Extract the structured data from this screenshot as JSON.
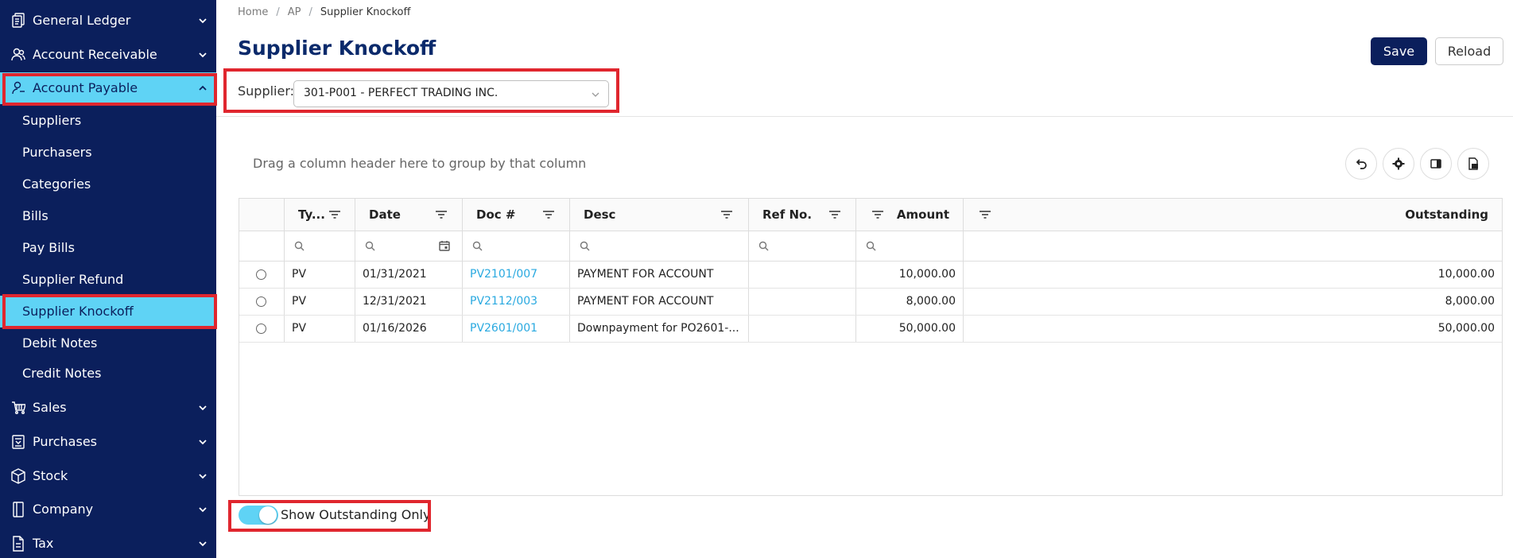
{
  "sidebar": {
    "groups": [
      {
        "label": "General Ledger",
        "icon": "ledger-icon"
      },
      {
        "label": "Account Receivable",
        "icon": "receivable-icon"
      },
      {
        "label": "Account Payable",
        "icon": "payable-icon"
      },
      {
        "label": "Sales",
        "icon": "cart-icon"
      },
      {
        "label": "Purchases",
        "icon": "purchase-doc-icon"
      },
      {
        "label": "Stock",
        "icon": "box-icon"
      },
      {
        "label": "Company",
        "icon": "building-icon"
      },
      {
        "label": "Tax",
        "icon": "tax-doc-icon"
      }
    ],
    "payable_items": [
      "Suppliers",
      "Purchasers",
      "Categories",
      "Bills",
      "Pay Bills",
      "Supplier Refund",
      "Supplier Knockoff",
      "Debit Notes",
      "Credit Notes"
    ],
    "active_item": "Supplier Knockoff"
  },
  "breadcrumb": {
    "home": "Home",
    "ap": "AP",
    "current": "Supplier Knockoff"
  },
  "page": {
    "title": "Supplier Knockoff"
  },
  "toolbar": {
    "save_label": "Save",
    "reload_label": "Reload"
  },
  "supplier": {
    "label": "Supplier:",
    "value": "301-P001 - PERFECT TRADING INC."
  },
  "grid": {
    "group_hint": "Drag a column header here to group by that column",
    "columns": [
      "Ty...",
      "Date",
      "Doc #",
      "Desc",
      "Ref No.",
      "Amount",
      "Outstanding"
    ],
    "rows": [
      {
        "type": "PV",
        "date": "01/31/2021",
        "doc": "PV2101/007",
        "desc": "PAYMENT FOR ACCOUNT",
        "ref": "",
        "amount": "10,000.00",
        "outstanding": "10,000.00"
      },
      {
        "type": "PV",
        "date": "12/31/2021",
        "doc": "PV2112/003",
        "desc": "PAYMENT FOR ACCOUNT",
        "ref": "",
        "amount": "8,000.00",
        "outstanding": "8,000.00"
      },
      {
        "type": "PV",
        "date": "01/16/2026",
        "doc": "PV2601/001",
        "desc": "Downpayment for PO2601-...",
        "ref": "",
        "amount": "50,000.00",
        "outstanding": "50,000.00"
      }
    ]
  },
  "toggle": {
    "label": "Show Outstanding Only",
    "on": true
  },
  "colors": {
    "sidebar": "#0b1f5c",
    "accent": "#5fd3f5",
    "highlight": "#e0262e",
    "link": "#29a9e0",
    "title": "#0b2a6b"
  }
}
